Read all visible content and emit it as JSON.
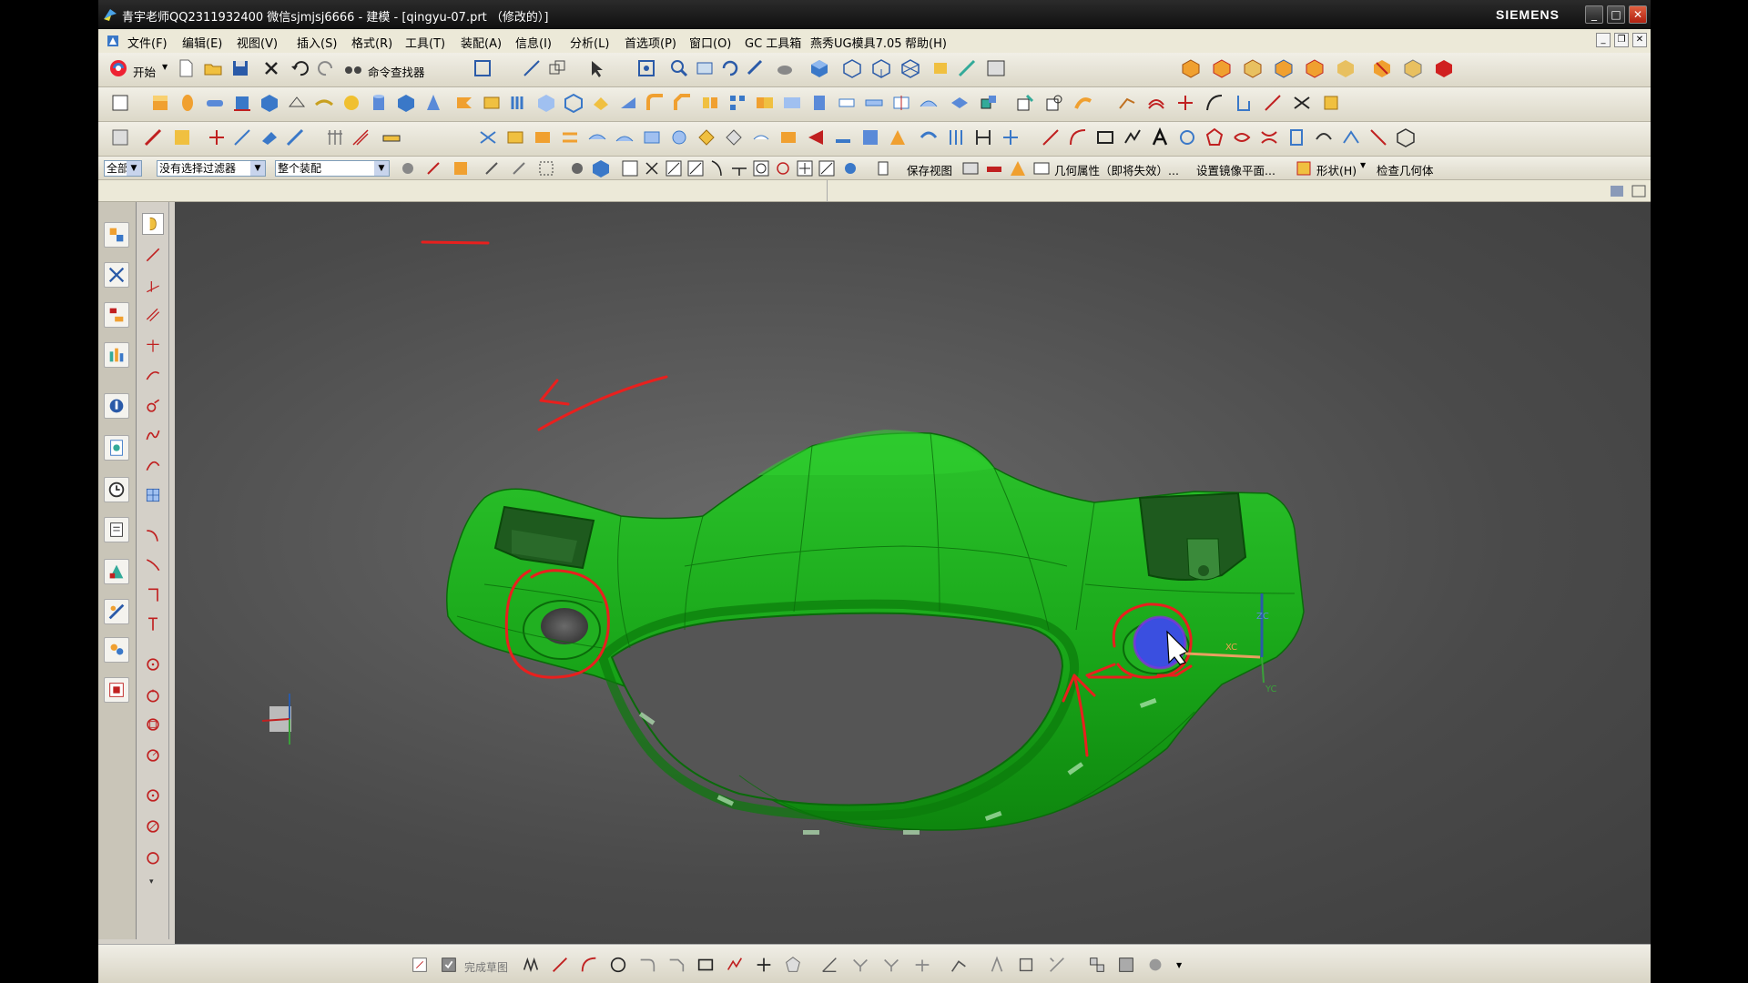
{
  "window": {
    "title": "青宇老师QQ2311932400 微信sjmjsj6666 - 建模 - [qingyu-07.prt （修改的）]",
    "brand": "SIEMENS"
  },
  "menu": {
    "items": [
      "文件(F)",
      "编辑(E)",
      "视图(V)",
      "插入(S)",
      "格式(R)",
      "工具(T)",
      "装配(A)",
      "信息(I)",
      "分析(L)",
      "首选项(P)",
      "窗口(O)",
      "GC 工具箱",
      "燕秀UG模具7.05",
      "帮助(H)"
    ]
  },
  "toolbar": {
    "start_label": "开始",
    "command_finder_label": "命令查找器"
  },
  "selection_bar": {
    "type_filter": "全部",
    "selection_filter": "没有选择过滤器",
    "scope": "整个装配",
    "save_view": "保存视图",
    "geometry_props": "几何属性（即将失效）...",
    "mirror_plane": "设置镜像平面...",
    "shape": "形状(H)",
    "check_geometry": "检查几何体"
  },
  "bottom_bar": {
    "finish_sketch": "完成草图"
  },
  "csys": {
    "x_label": "XC",
    "y_label": "YC",
    "z_label": "ZC"
  },
  "colors": {
    "part_green": "#1fae1f",
    "annotation_red": "#e8201e",
    "highlight_blue": "#3a4fe0"
  },
  "icons": [
    "start-icon",
    "new-icon",
    "open-icon",
    "save-icon",
    "cut-icon",
    "undo-icon",
    "redo-icon",
    "binoculars-icon",
    "fit-icon",
    "zoom-icon",
    "rotate-icon",
    "cube-icon",
    "sphere-icon",
    "cylinder-icon",
    "cone-icon",
    "line-icon",
    "arc-icon",
    "circle-icon",
    "rectangle-icon",
    "text-icon"
  ]
}
